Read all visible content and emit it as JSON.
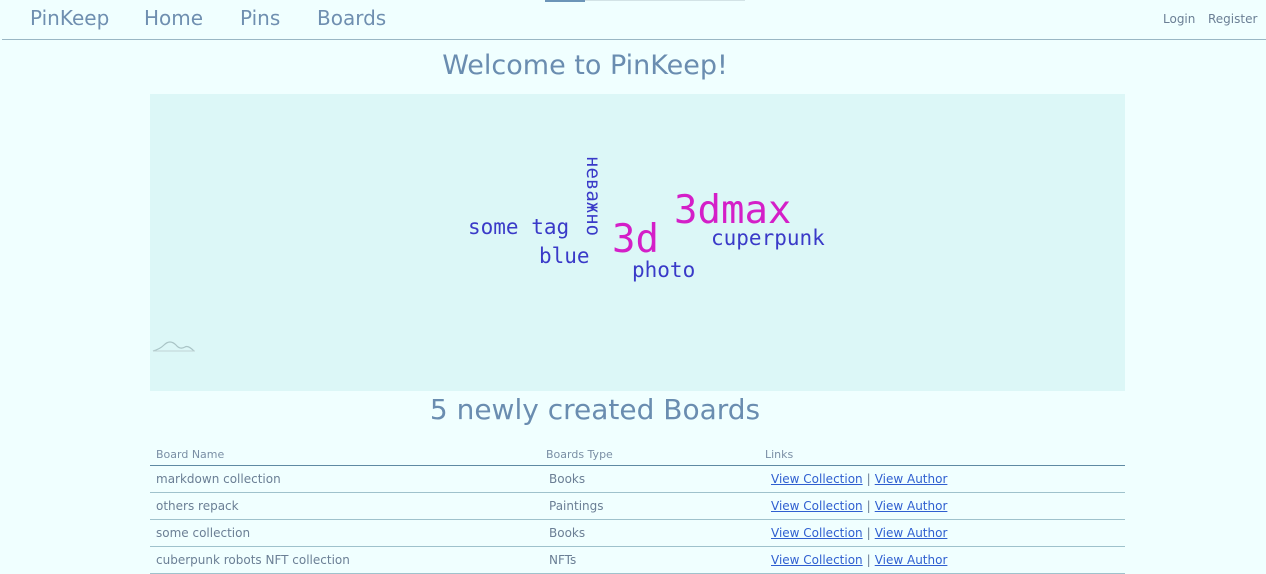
{
  "nav": {
    "brand": "PinKeep",
    "links": [
      "Home",
      "Pins",
      "Boards"
    ],
    "login": "Login",
    "register": "Register"
  },
  "welcome": "Welcome to PinKeep!",
  "tag_cloud": {
    "tags": [
      {
        "text": "some tag",
        "color": "#3a3ac8"
      },
      {
        "text": "blue",
        "color": "#3a3ac8"
      },
      {
        "text": "неважно",
        "color": "#3a3ac8"
      },
      {
        "text": "3d",
        "color": "#d41fc8"
      },
      {
        "text": "3dmax",
        "color": "#d41fc8"
      },
      {
        "text": "cuperpunk",
        "color": "#3a3ac8"
      },
      {
        "text": "photo",
        "color": "#3a3ac8"
      }
    ]
  },
  "boards_section": {
    "title": "5 newly created Boards",
    "headers": {
      "name": "Board Name",
      "type": "Boards Type",
      "links": "Links"
    },
    "rows": [
      {
        "name": "markdown collection",
        "type": "Books",
        "view_collection": "View Collection",
        "view_author": "View Author"
      },
      {
        "name": "others repack",
        "type": "Paintings",
        "view_collection": "View Collection",
        "view_author": "View Author"
      },
      {
        "name": "some collection",
        "type": "Books",
        "view_collection": "View Collection",
        "view_author": "View Author"
      },
      {
        "name": "cuberpunk robots NFT collection",
        "type": "NFTs",
        "view_collection": "View Collection",
        "view_author": "View Author"
      }
    ],
    "separator": "|"
  }
}
